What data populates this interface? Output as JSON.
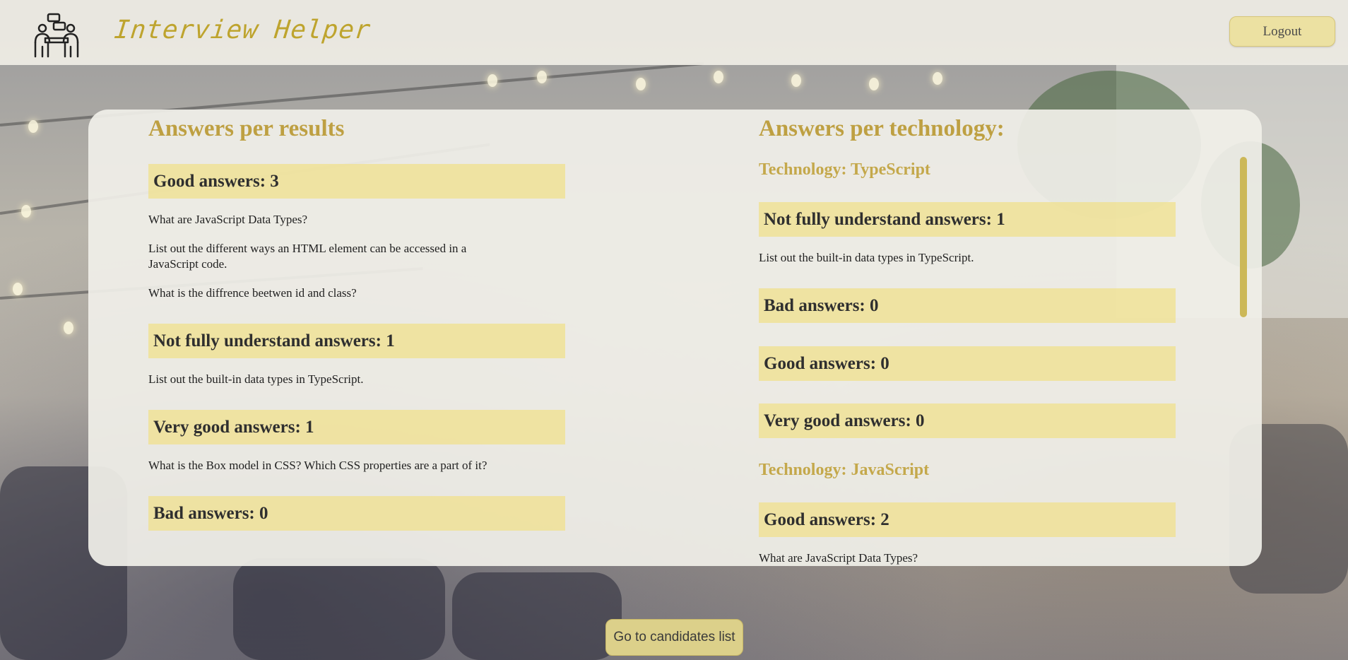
{
  "app": {
    "title": "Interview Helper"
  },
  "header": {
    "logout_label": "Logout"
  },
  "results": {
    "title": "Answers per results",
    "groups": [
      {
        "label": "Good answers: 3",
        "questions": [
          "What are JavaScript Data Types?",
          "List out the different ways an HTML element can be accessed in a JavaScript code.",
          "What is the diffrence beetwen id and class?"
        ]
      },
      {
        "label": "Not fully understand answers: 1",
        "questions": [
          "List out the built-in data types in TypeScript."
        ]
      },
      {
        "label": "Very good answers: 1",
        "questions": [
          "What is the Box model in CSS? Which CSS properties are a part of it?"
        ]
      },
      {
        "label": "Bad answers: 0",
        "questions": []
      }
    ]
  },
  "technology": {
    "title": "Answers per technology:",
    "techs": [
      {
        "name": "Technology: TypeScript",
        "groups": [
          {
            "label": "Not fully understand answers: 1",
            "questions": [
              "List out the built-in data types in TypeScript."
            ]
          },
          {
            "label": "Bad answers: 0",
            "questions": []
          },
          {
            "label": "Good answers: 0",
            "questions": []
          },
          {
            "label": "Very good answers: 0",
            "questions": []
          }
        ]
      },
      {
        "name": "Technology: JavaScript",
        "groups": [
          {
            "label": "Good answers: 2",
            "questions": [
              "What are JavaScript Data Types?"
            ]
          }
        ]
      }
    ]
  },
  "footer": {
    "candidates_label": "Go to candidates list"
  }
}
